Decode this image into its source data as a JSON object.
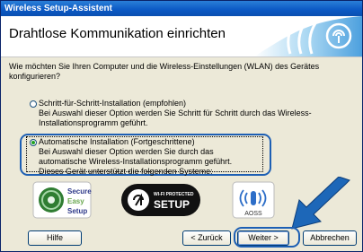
{
  "window": {
    "title": "Wireless Setup-Assistent"
  },
  "header": {
    "title": "Drahtlose Kommunikation einrichten"
  },
  "main": {
    "question": "Wie möchten Sie Ihren Computer und die Wireless-Einstellungen (WLAN) des Gerätes konfigurieren?",
    "options": [
      {
        "label": "Schritt-für-Schritt-Installation (empfohlen)",
        "description": "Bei Auswahl dieser Option werden Sie Schritt für Schritt durch das Wireless-Installationsprogramm geführt.",
        "selected": false
      },
      {
        "label": "Automatische Installation (Fortgeschrittene)",
        "description": "Bei Auswahl dieser Option werden Sie durch das automatische Wireless-Installationsprogramm geführt.",
        "extra": "Dieses Gerät unterstützt die folgenden Systeme:",
        "selected": true
      }
    ],
    "logos": {
      "ses": [
        "Secure",
        "Easy",
        "Setup"
      ],
      "wps": {
        "small": "WI-FI PROTECTED",
        "big": "SETUP"
      },
      "aoss": "AOSS"
    }
  },
  "buttons": {
    "help": "Hilfe",
    "back": "< Zurück",
    "next": "Weiter >",
    "cancel": "Abbrechen"
  },
  "colors": {
    "accent": "#1d5fb4",
    "radio_selected": "#21a121",
    "titlebar": "#0b58c4"
  }
}
